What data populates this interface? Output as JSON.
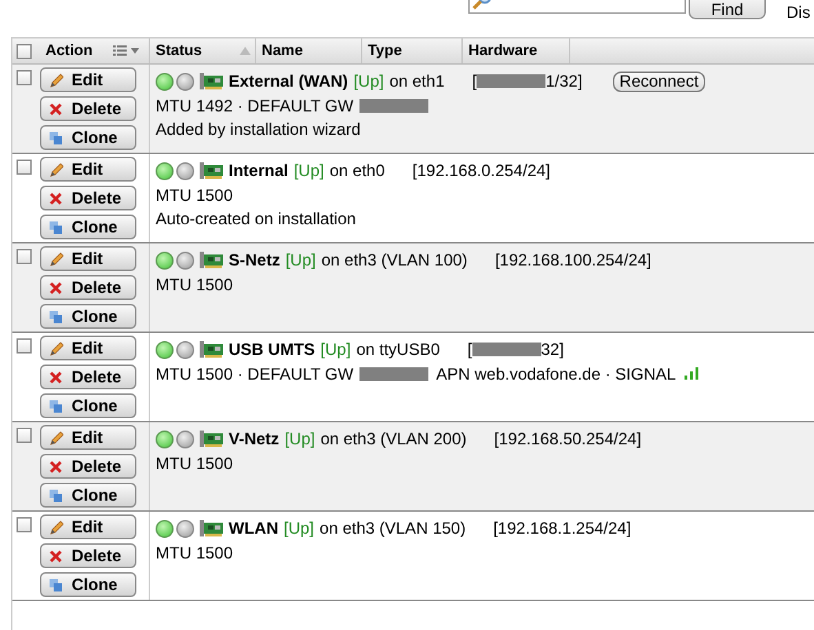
{
  "toolbar": {
    "find_button": "Find",
    "cut_label": "Dis"
  },
  "table": {
    "select_all_checked": false,
    "columns": [
      {
        "label": "Action",
        "menu": true,
        "sorted": false
      },
      {
        "label": "Status",
        "menu": false,
        "sorted": true
      },
      {
        "label": "Name",
        "menu": false,
        "sorted": false
      },
      {
        "label": "Type",
        "menu": false,
        "sorted": false
      },
      {
        "label": "Hardware",
        "menu": false,
        "sorted": false
      }
    ],
    "rows": [
      {
        "buttons": [
          "Edit",
          "Delete",
          "Clone"
        ],
        "checked": false,
        "link_on": true,
        "admin_on": false,
        "title_line": [
          {
            "kind": "name",
            "text": "External (WAN)"
          },
          {
            "kind": "state",
            "text": "[Up]"
          },
          {
            "kind": "text",
            "text": "on eth1"
          }
        ],
        "address": [
          {
            "kind": "text",
            "text": "["
          },
          {
            "kind": "redacted"
          },
          {
            "kind": "text",
            "text": "1/32]"
          }
        ],
        "action": "Reconnect",
        "lines": [
          [
            {
              "kind": "text",
              "text": "MTU 1492 · DEFAULT GW"
            },
            {
              "kind": "redacted"
            }
          ],
          [
            {
              "kind": "text",
              "text": "Added by installation wizard"
            }
          ]
        ]
      },
      {
        "buttons": [
          "Edit",
          "Delete",
          "Clone"
        ],
        "checked": false,
        "link_on": true,
        "admin_on": false,
        "title_line": [
          {
            "kind": "name",
            "text": "Internal"
          },
          {
            "kind": "state",
            "text": "[Up]"
          },
          {
            "kind": "text",
            "text": "on eth0"
          }
        ],
        "address": [
          {
            "kind": "text",
            "text": "[192.168.0.254/24]"
          }
        ],
        "lines": [
          [
            {
              "kind": "text",
              "text": "MTU 1500"
            }
          ],
          [
            {
              "kind": "text",
              "text": "Auto-created on installation"
            }
          ]
        ]
      },
      {
        "buttons": [
          "Edit",
          "Delete",
          "Clone"
        ],
        "checked": false,
        "link_on": true,
        "admin_on": false,
        "title_line": [
          {
            "kind": "name",
            "text": "S-Netz"
          },
          {
            "kind": "state",
            "text": "[Up]"
          },
          {
            "kind": "text",
            "text": "on eth3 (VLAN 100)"
          }
        ],
        "address": [
          {
            "kind": "text",
            "text": "[192.168.100.254/24]"
          }
        ],
        "lines": [
          [
            {
              "kind": "text",
              "text": "MTU 1500"
            }
          ]
        ]
      },
      {
        "buttons": [
          "Edit",
          "Delete",
          "Clone"
        ],
        "checked": false,
        "link_on": true,
        "admin_on": false,
        "title_line": [
          {
            "kind": "name",
            "text": "USB UMTS"
          },
          {
            "kind": "state",
            "text": "[Up]"
          },
          {
            "kind": "text",
            "text": "on ttyUSB0"
          }
        ],
        "address": [
          {
            "kind": "text",
            "text": "["
          },
          {
            "kind": "redacted"
          },
          {
            "kind": "text",
            "text": "32]"
          }
        ],
        "lines": [
          [
            {
              "kind": "text",
              "text": "MTU 1500 · DEFAULT GW"
            },
            {
              "kind": "redacted"
            },
            {
              "kind": "text",
              "text": "APN web.vodafone.de · SIGNAL"
            },
            {
              "kind": "signal"
            }
          ]
        ]
      },
      {
        "buttons": [
          "Edit",
          "Delete",
          "Clone"
        ],
        "checked": false,
        "link_on": true,
        "admin_on": false,
        "title_line": [
          {
            "kind": "name",
            "text": "V-Netz"
          },
          {
            "kind": "state",
            "text": "[Up]"
          },
          {
            "kind": "text",
            "text": "on eth3 (VLAN 200)"
          }
        ],
        "address": [
          {
            "kind": "text",
            "text": "[192.168.50.254/24]"
          }
        ],
        "lines": [
          [
            {
              "kind": "text",
              "text": "MTU 1500"
            }
          ]
        ]
      },
      {
        "buttons": [
          "Edit",
          "Delete",
          "Clone"
        ],
        "checked": false,
        "link_on": true,
        "admin_on": false,
        "title_line": [
          {
            "kind": "name",
            "text": "WLAN"
          },
          {
            "kind": "state",
            "text": "[Up]"
          },
          {
            "kind": "text",
            "text": "on eth3 (VLAN 150)"
          }
        ],
        "address": [
          {
            "kind": "text",
            "text": "[192.168.1.254/24]"
          }
        ],
        "lines": [
          [
            {
              "kind": "text",
              "text": "MTU 1500"
            }
          ]
        ]
      }
    ]
  }
}
